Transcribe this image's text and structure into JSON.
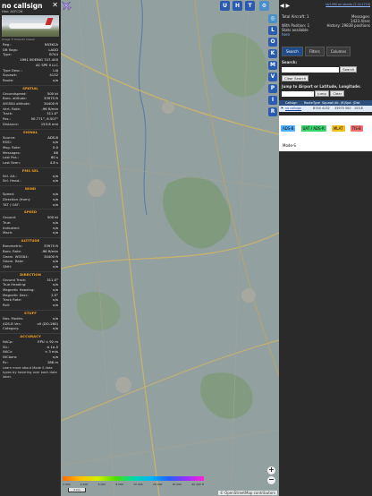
{
  "aircraft": {
    "callsign": "no callsign",
    "hex_label": "Hex:",
    "hex": "ACFC26",
    "photo_credit": "Image © Roberto Cassar",
    "close": "✕"
  },
  "details": [
    {
      "k": "Reg.:",
      "v": "N53KCA"
    },
    {
      "k": "DB flags:",
      "v": "LADD"
    },
    {
      "k": "Type:",
      "v": "B744"
    },
    {
      "k": "",
      "v": "1991 BOEING 747-400"
    },
    {
      "k": "",
      "v": "AC SPE II LLC"
    },
    {
      "k": "Type Desc.:",
      "v": "L4J"
    },
    {
      "k": "Squawk:",
      "v": "4132"
    },
    {
      "k": "Route:",
      "v": "n/a"
    }
  ],
  "sections": [
    {
      "title": "SPATIAL",
      "rows": [
        {
          "k": "Groundspeed:",
          "v": "500 kt"
        },
        {
          "k": "Baro. altitude:",
          "v": "33975 ft"
        },
        {
          "k": "WGS84 altitude:",
          "v": "34400 ft"
        },
        {
          "k": "Vert. Rate:",
          "v": "-96 ft/min"
        },
        {
          "k": "Track:",
          "v": "311.0°"
        },
        {
          "k": "Pos.:",
          "v": "50.771°, 6.507°"
        },
        {
          "k": "Distance:",
          "v": "153.8 nmi"
        }
      ]
    },
    {
      "title": "SIGNAL",
      "rows": [
        {
          "k": "Source:",
          "v": "ADS-B"
        },
        {
          "k": "RSSI:",
          "v": "n/a"
        },
        {
          "k": "Msg. Rate:",
          "v": "0.0"
        },
        {
          "k": "Messages:",
          "v": "86"
        },
        {
          "k": "Last Pos.:",
          "v": "60 s"
        },
        {
          "k": "Last Seen:",
          "v": "4.8 s"
        }
      ]
    },
    {
      "title": "FMS SEL",
      "rows": [
        {
          "k": "Sel. Alt.:",
          "v": "n/a"
        },
        {
          "k": "Sel. Head.:",
          "v": "n/a"
        }
      ]
    },
    {
      "title": "WIND",
      "rows": [
        {
          "k": "Speed:",
          "v": "n/a"
        },
        {
          "k": "Direction (from):",
          "v": "n/a"
        },
        {
          "k": "TAT / OAT:",
          "v": "n/a"
        }
      ]
    },
    {
      "title": "SPEED",
      "rows": [
        {
          "k": "Ground:",
          "v": "500 kt"
        },
        {
          "k": "True:",
          "v": "n/a"
        },
        {
          "k": "Indicated:",
          "v": "n/a"
        },
        {
          "k": "Mach:",
          "v": "n/a"
        }
      ]
    },
    {
      "title": "ALTITUDE",
      "rows": [
        {
          "k": "Barometric:",
          "v": "33975 ft"
        },
        {
          "k": "Baro. Rate:",
          "v": "-96 ft/min"
        },
        {
          "k": "Geom. WGS84:",
          "v": "34400 ft"
        },
        {
          "k": "Geom. Rate:",
          "v": "n/a"
        },
        {
          "k": "QNH:",
          "v": "n/a"
        }
      ]
    },
    {
      "title": "DIRECTION",
      "rows": [
        {
          "k": "Ground Track:",
          "v": "311.0°"
        },
        {
          "k": "True Heading:",
          "v": "n/a"
        },
        {
          "k": "Magnetic Heading:",
          "v": "n/a"
        },
        {
          "k": "Magnetic Decl.:",
          "v": "2.5°"
        },
        {
          "k": "Track Rate:",
          "v": "n/a"
        },
        {
          "k": "Roll:",
          "v": "n/a"
        }
      ]
    },
    {
      "title": "STUFF",
      "rows": [
        {
          "k": "Nav. Modes:",
          "v": "n/a"
        },
        {
          "k": "ADS-B Ver.:",
          "v": "v0 (DO-260)"
        },
        {
          "k": "Category:",
          "v": "n/a"
        }
      ]
    },
    {
      "title": "ACCURACY",
      "rows": [
        {
          "k": "NACp:",
          "v": "EPU < 92 m"
        },
        {
          "k": "SIL:",
          "v": "≤ 1e-5"
        },
        {
          "k": "NACv:",
          "v": "< 3 m/s"
        },
        {
          "k": "NICbaro:",
          "v": "n/a"
        },
        {
          "k": "Rc:",
          "v": "186 m"
        }
      ]
    }
  ],
  "footnote": "Learn more about Mode S data types by hovering over each data label.",
  "map": {
    "top_buttons": [
      "U",
      "H",
      "T"
    ],
    "side_buttons": [
      "L",
      "O",
      "K",
      "M",
      "V",
      "P",
      "I",
      "R"
    ],
    "zoom_in": "+",
    "zoom_out": "−",
    "scale_label": "2 km",
    "alt_ticks": [
      "2 000",
      "4 000",
      "6 000",
      "8 000",
      "10 000",
      "20 000",
      "30 000",
      "40 000 ft"
    ],
    "attribution": "© OpenStreetMap contributors",
    "colors": {
      "land": "#93a0a0",
      "forest": "#7f9a7c",
      "road": "#c9b36a",
      "water": "#5f7fa8"
    }
  },
  "stats": {
    "nav": "◀ ▶",
    "version": "tar1090 on ubuntu (2.14.1710)",
    "total_label": "Total Aircraft:",
    "total": "1",
    "with_pos_label": "With Position:",
    "with_pos": "1",
    "messages_label": "Messages:",
    "messages": "1423.4/sec",
    "history_label": "History:",
    "history": "29838 positions",
    "stats_label": "Stats available",
    "stats_link": "here"
  },
  "tabs": [
    "Search",
    "Filters",
    "Columns"
  ],
  "search": {
    "label": "Search:",
    "button": "Search",
    "clear_button": "Clear Search",
    "jump_label": "Jump to Airport or Latitude, Longitude:",
    "jump_button": "Jump",
    "clear": "Clear"
  },
  "table": {
    "headers": [
      "",
      "Callsign",
      "Route",
      "Type",
      "Squawk",
      "Alt. (ft)",
      "Spd. (kt)",
      "Dist"
    ],
    "rows": [
      [
        "",
        "no callsign",
        "",
        "B744",
        "4132",
        "33975",
        "500",
        "153.8"
      ]
    ]
  },
  "filters": [
    "ADS-B",
    "UAT / ADS-R",
    "MLAT",
    "TIS-B",
    "Mode-S"
  ]
}
